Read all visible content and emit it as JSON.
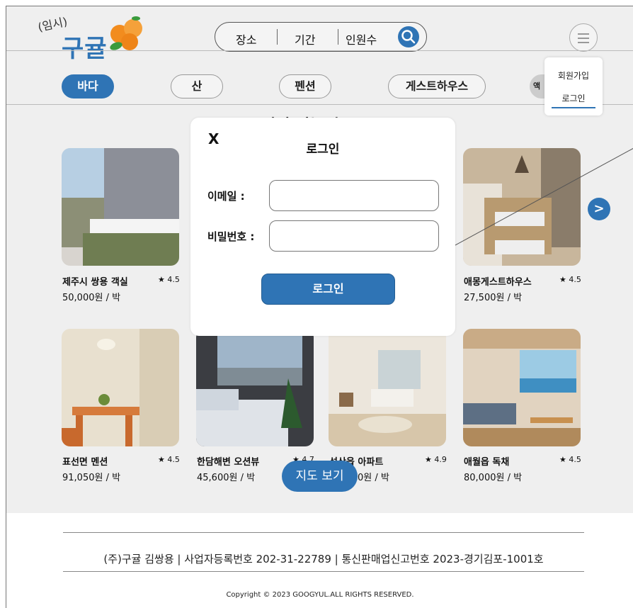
{
  "header": {
    "temp_label": "(임시)",
    "logo": "구귤",
    "search": {
      "place": "장소",
      "period": "기간",
      "guests": "인원수"
    }
  },
  "categories": [
    {
      "label": "바다",
      "active": true
    },
    {
      "label": "산",
      "active": false
    },
    {
      "label": "펜션",
      "active": false
    },
    {
      "label": "게스트하우스",
      "active": false
    },
    {
      "label": "액",
      "active": false
    }
  ],
  "menu": {
    "signup": "회원가입",
    "login": "로그인"
  },
  "section_title": "인기 있는 숙소",
  "listings": [
    {
      "name": "제주시 쌍용 객실",
      "rating": "★ 4.5",
      "price": "50,000원 / 박"
    },
    {
      "name": "애몽게스트하우스",
      "rating": "★ 4.5",
      "price": "27,500원 / 박"
    },
    {
      "name": "표선면 멘션",
      "rating": "★ 4.5",
      "price": "91,050원 / 박"
    },
    {
      "name": "한담해변 오션뷰",
      "rating": "★ 4.7",
      "price": "45,600원 / 박"
    },
    {
      "name": "성산읍 아파트",
      "rating": "★ 4.9",
      "price": "0원 / 박"
    },
    {
      "name": "애월읍 독채",
      "rating": "★ 4.5",
      "price": "80,000원 / 박"
    }
  ],
  "next_label": ">",
  "map_button": "지도 보기",
  "login_modal": {
    "close": "X",
    "title": "로그인",
    "email_label": "이메일 :",
    "password_label": "비밀번호 :",
    "submit": "로그인"
  },
  "footer": {
    "info": "(주)구귤   김쌍용  |  사업자등록번호  202-31-22789  |  통신판매업신고번호   2023-경기김포-1001호",
    "copyright": "Copyright © 2023 GOOGYUL.ALL RIGHTS RESERVED."
  },
  "colors": {
    "accent": "#2f74b5",
    "page_bg": "#efefef",
    "tangerine": "#f28c1e"
  }
}
